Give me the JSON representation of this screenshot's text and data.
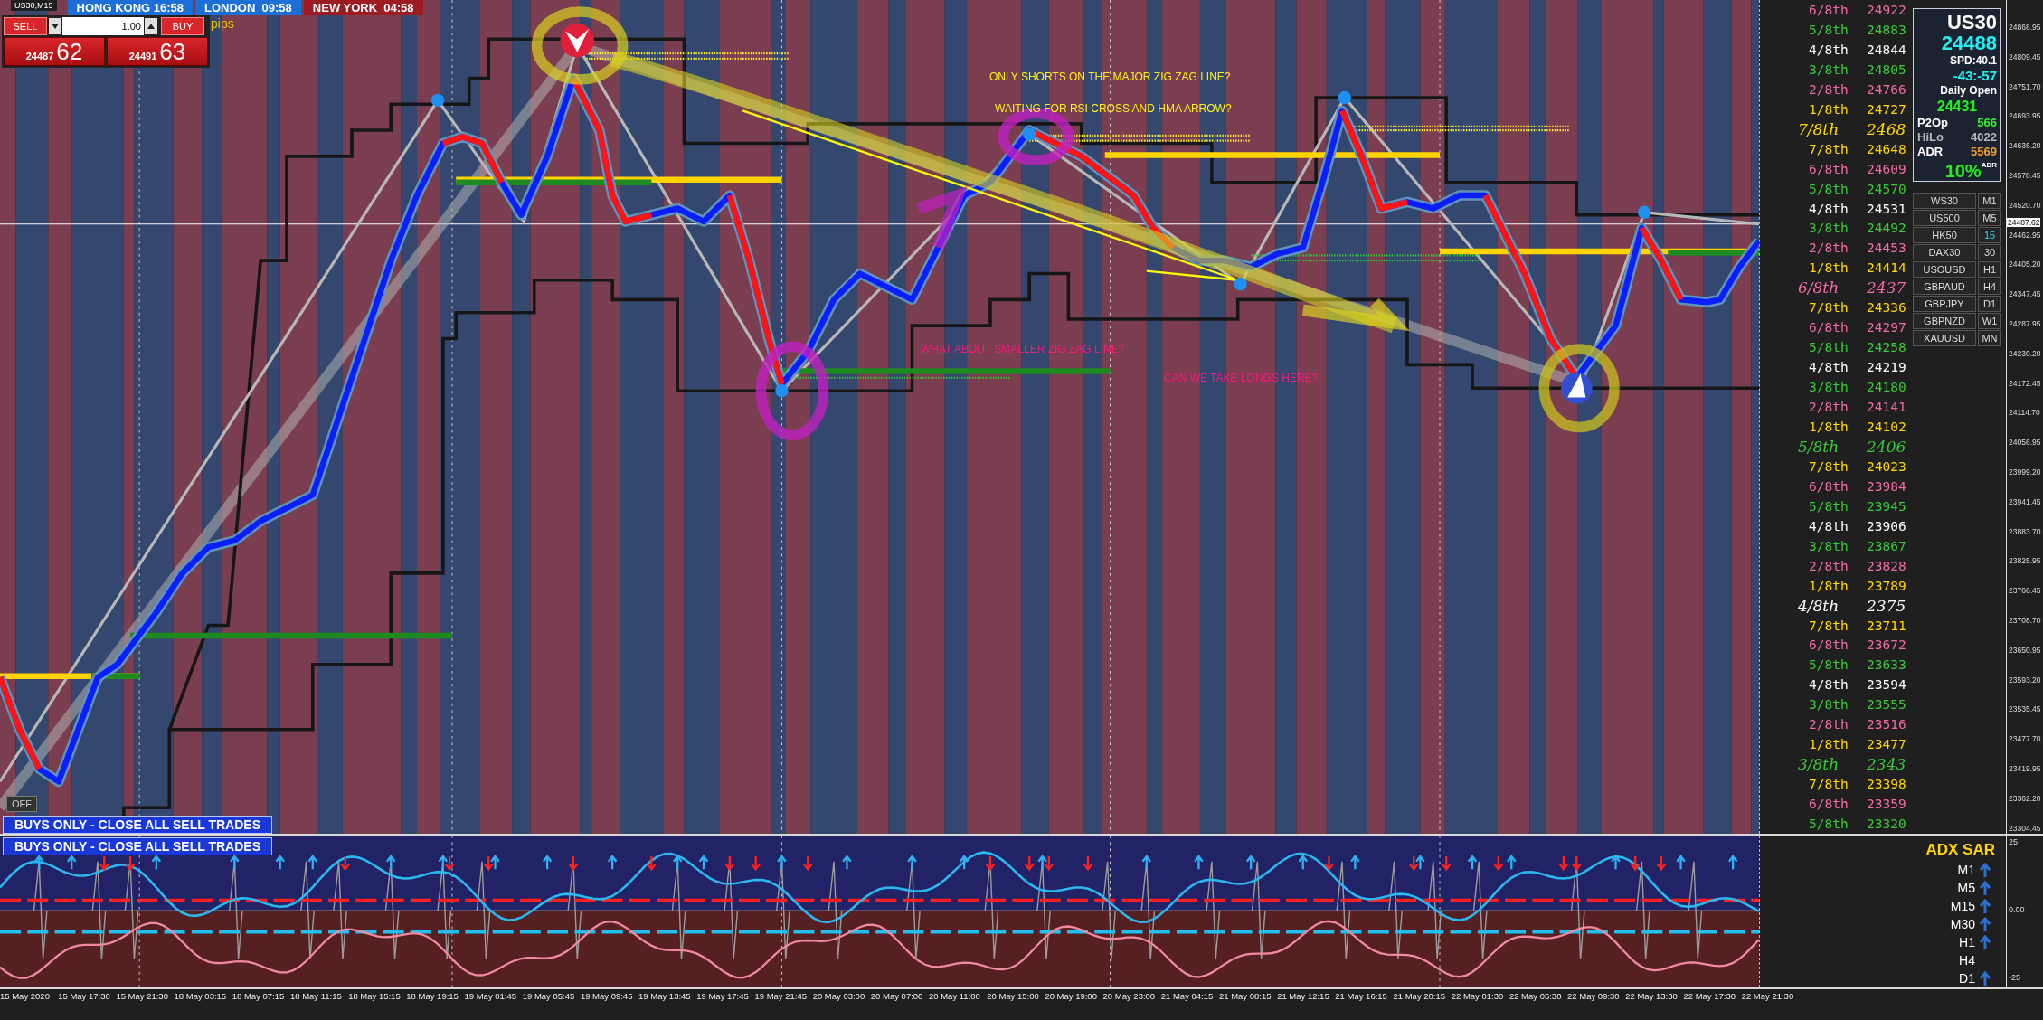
{
  "chart_title": "US30,M15",
  "sessions": [
    {
      "label": "HONG KONG 16:58",
      "color": "#1c6fd6"
    },
    {
      "label": "LONDON  09:58",
      "color": "#1c6fd6"
    },
    {
      "label": "NEW YORK  04:58",
      "color": "#9c1c22"
    }
  ],
  "trade_panel": {
    "sell": "SELL",
    "buy": "BUY",
    "lots": "1.00",
    "bid_prefix": "24487",
    "bid_pips": "62",
    "ask_prefix": "24491",
    "ask_pips": "63",
    "unit": "pips"
  },
  "annotations": [
    {
      "text": "ONLY SHORTS ON THE MAJOR ZIG ZAG LINE?",
      "color": "#ffee22"
    },
    {
      "text": "WAITING FOR RSI CROSS AND HMA ARROW?",
      "color": "#ffee22"
    },
    {
      "text": "WHAT ABOUT SMALLER ZIG ZAG LINE?",
      "color": "#ee1f7a"
    },
    {
      "text": "CAN WE TAKE LONGS HERE?",
      "color": "#ee1f7a"
    }
  ],
  "off_button": "OFF",
  "main_banner": "BUYS ONLY - CLOSE ALL SELL TRADES",
  "murrey": [
    {
      "label": "6/8th",
      "value": "24922",
      "color": "#f06aa8",
      "kind": "minor"
    },
    {
      "label": "5/8th",
      "value": "24883",
      "color": "#3cc83c",
      "kind": "minor"
    },
    {
      "label": "4/8th",
      "value": "24844",
      "color": "#ffffff",
      "kind": "minor"
    },
    {
      "label": "3/8th",
      "value": "24805",
      "color": "#3cc83c",
      "kind": "minor"
    },
    {
      "label": "2/8th",
      "value": "24766",
      "color": "#f06aa8",
      "kind": "minor"
    },
    {
      "label": "1/8th",
      "value": "24727",
      "color": "#ffd700",
      "kind": "minor"
    },
    {
      "label": "7/8th",
      "value": "2468",
      "color": "#ffd700",
      "kind": "major"
    },
    {
      "label": "7/8th",
      "value": "24648",
      "color": "#ffd700",
      "kind": "minor"
    },
    {
      "label": "6/8th",
      "value": "24609",
      "color": "#f06aa8",
      "kind": "minor"
    },
    {
      "label": "5/8th",
      "value": "24570",
      "color": "#3cc83c",
      "kind": "minor"
    },
    {
      "label": "4/8th",
      "value": "24531",
      "color": "#ffffff",
      "kind": "minor"
    },
    {
      "label": "3/8th",
      "value": "24492",
      "color": "#3cc83c",
      "kind": "minor"
    },
    {
      "label": "2/8th",
      "value": "24453",
      "color": "#f06aa8",
      "kind": "minor"
    },
    {
      "label": "1/8th",
      "value": "24414",
      "color": "#ffd700",
      "kind": "minor"
    },
    {
      "label": "6/8th",
      "value": "2437",
      "color": "#f06aa8",
      "kind": "major"
    },
    {
      "label": "7/8th",
      "value": "24336",
      "color": "#ffd700",
      "kind": "minor"
    },
    {
      "label": "6/8th",
      "value": "24297",
      "color": "#f06aa8",
      "kind": "minor"
    },
    {
      "label": "5/8th",
      "value": "24258",
      "color": "#3cc83c",
      "kind": "minor"
    },
    {
      "label": "4/8th",
      "value": "24219",
      "color": "#ffffff",
      "kind": "minor"
    },
    {
      "label": "3/8th",
      "value": "24180",
      "color": "#3cc83c",
      "kind": "minor"
    },
    {
      "label": "2/8th",
      "value": "24141",
      "color": "#f06aa8",
      "kind": "minor"
    },
    {
      "label": "1/8th",
      "value": "24102",
      "color": "#ffd700",
      "kind": "minor"
    },
    {
      "label": "5/8th",
      "value": "2406",
      "color": "#3cc83c",
      "kind": "major"
    },
    {
      "label": "7/8th",
      "value": "24023",
      "color": "#ffd700",
      "kind": "minor"
    },
    {
      "label": "6/8th",
      "value": "23984",
      "color": "#f06aa8",
      "kind": "minor"
    },
    {
      "label": "5/8th",
      "value": "23945",
      "color": "#3cc83c",
      "kind": "minor"
    },
    {
      "label": "4/8th",
      "value": "23906",
      "color": "#ffffff",
      "kind": "minor"
    },
    {
      "label": "3/8th",
      "value": "23867",
      "color": "#3cc83c",
      "kind": "minor"
    },
    {
      "label": "2/8th",
      "value": "23828",
      "color": "#f06aa8",
      "kind": "minor"
    },
    {
      "label": "1/8th",
      "value": "23789",
      "color": "#ffd700",
      "kind": "minor"
    },
    {
      "label": "4/8th",
      "value": "2375",
      "color": "#ffffff",
      "kind": "major"
    },
    {
      "label": "7/8th",
      "value": "23711",
      "color": "#ffd700",
      "kind": "minor"
    },
    {
      "label": "6/8th",
      "value": "23672",
      "color": "#f06aa8",
      "kind": "minor"
    },
    {
      "label": "5/8th",
      "value": "23633",
      "color": "#3cc83c",
      "kind": "minor"
    },
    {
      "label": "4/8th",
      "value": "23594",
      "color": "#ffffff",
      "kind": "minor"
    },
    {
      "label": "3/8th",
      "value": "23555",
      "color": "#3cc83c",
      "kind": "minor"
    },
    {
      "label": "2/8th",
      "value": "23516",
      "color": "#f06aa8",
      "kind": "minor"
    },
    {
      "label": "1/8th",
      "value": "23477",
      "color": "#ffd700",
      "kind": "minor"
    },
    {
      "label": "3/8th",
      "value": "2343",
      "color": "#3cc83c",
      "kind": "major"
    },
    {
      "label": "7/8th",
      "value": "23398",
      "color": "#ffd700",
      "kind": "minor"
    },
    {
      "label": "6/8th",
      "value": "23359",
      "color": "#f06aa8",
      "kind": "minor"
    },
    {
      "label": "5/8th",
      "value": "23320",
      "color": "#3cc83c",
      "kind": "minor"
    }
  ],
  "info": {
    "symbol": "US30",
    "price": "24488",
    "spread": "SPD:40.1",
    "range": "-43:-57",
    "daily_open_label": "Daily Open",
    "daily_open": "24431",
    "p2op_label": "P2Op",
    "p2op": "566",
    "hilo_label": "HiLo",
    "hilo": "4022",
    "adr_label": "ADR",
    "adr": "5569",
    "adr_pct": "10%",
    "adr_pct_label": "ADR"
  },
  "symbols": [
    {
      "symbol": "WS30",
      "timeframe": "M1",
      "selected": false
    },
    {
      "symbol": "US500",
      "timeframe": "M5",
      "selected": false
    },
    {
      "symbol": "HK50",
      "timeframe": "15",
      "selected": true
    },
    {
      "symbol": "DAX30",
      "timeframe": "30",
      "selected": false
    },
    {
      "symbol": "USOUSD",
      "timeframe": "H1",
      "selected": false
    },
    {
      "symbol": "GBPAUD",
      "timeframe": "H4",
      "selected": false
    },
    {
      "symbol": "GBPJPY",
      "timeframe": "D1",
      "selected": false
    },
    {
      "symbol": "GBPNZD",
      "timeframe": "W1",
      "selected": false
    },
    {
      "symbol": "XAUUSD",
      "timeframe": "MN",
      "selected": false
    }
  ],
  "price_axis": [
    "24868.95",
    "24809.45",
    "24751.70",
    "24693.95",
    "24636.20",
    "24578.45",
    "24520.70",
    "24462.95",
    "24405.20",
    "24347.45",
    "24287.95",
    "24230.20",
    "24172.45",
    "24114.70",
    "24056.95",
    "23999.20",
    "23941.45",
    "23883.70",
    "23825.95",
    "23766.45",
    "23708.70",
    "23650.95",
    "23593.20",
    "23535.45",
    "23477.70",
    "23419.95",
    "23362.20",
    "23304.45"
  ],
  "current_price": "24487.62",
  "indicator": {
    "banner": "BUYS ONLY - CLOSE ALL SELL TRADES",
    "title": "ADX SAR",
    "rows": [
      {
        "label": "M1",
        "arrow": true
      },
      {
        "label": "M5",
        "arrow": true
      },
      {
        "label": "M15",
        "arrow": true
      },
      {
        "label": "M30",
        "arrow": true
      },
      {
        "label": "H1",
        "arrow": true
      },
      {
        "label": "H4",
        "arrow": false
      },
      {
        "label": "D1",
        "arrow": true
      }
    ],
    "axis": [
      "25",
      "0.00",
      "-25"
    ]
  },
  "time_axis": [
    "15 May 2020",
    "15 May 17:30",
    "15 May 21:30",
    "18 May 03:15",
    "18 May 07:15",
    "18 May 11:15",
    "18 May 15:15",
    "18 May 19:15",
    "19 May 01:45",
    "19 May 05:45",
    "19 May 09:45",
    "19 May 13:45",
    "19 May 17:45",
    "19 May 21:45",
    "20 May 03:00",
    "20 May 07:00",
    "20 May 11:00",
    "20 May 15:00",
    "20 May 19:00",
    "20 May 23:00",
    "21 May 04:15",
    "21 May 08:15",
    "21 May 12:15",
    "21 May 16:15",
    "21 May 20:15",
    "22 May 01:30",
    "22 May 05:30",
    "22 May 09:30",
    "22 May 13:30",
    "22 May 17:30",
    "22 May 21:30"
  ]
}
